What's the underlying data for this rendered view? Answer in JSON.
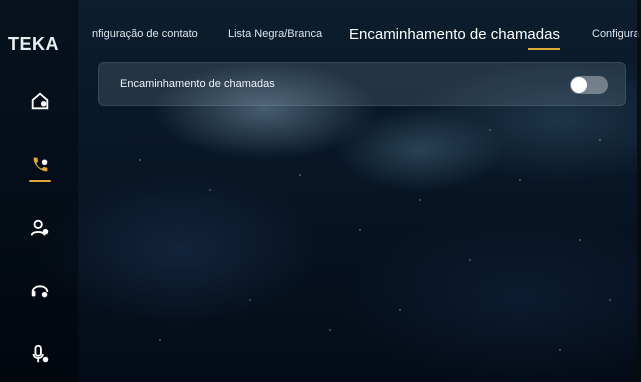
{
  "brand": {
    "logo_text": "TEKA",
    "accent_color": "#e0a63a"
  },
  "sidebar": {
    "items": [
      {
        "icon": "home-icon",
        "active": false
      },
      {
        "icon": "phone-icon",
        "active": true
      },
      {
        "icon": "contact-icon",
        "active": false
      },
      {
        "icon": "headset-icon",
        "active": false
      },
      {
        "icon": "microphone-icon",
        "active": false
      }
    ]
  },
  "tabs": [
    {
      "label": "nfiguração de contato",
      "active": false
    },
    {
      "label": "Lista Negra/Branca",
      "active": false
    },
    {
      "label": "Encaminhamento de chamadas",
      "active": true
    },
    {
      "label": "Configura",
      "active": false
    }
  ],
  "setting": {
    "label": "Encaminhamento de chamadas",
    "toggle_on": false
  }
}
